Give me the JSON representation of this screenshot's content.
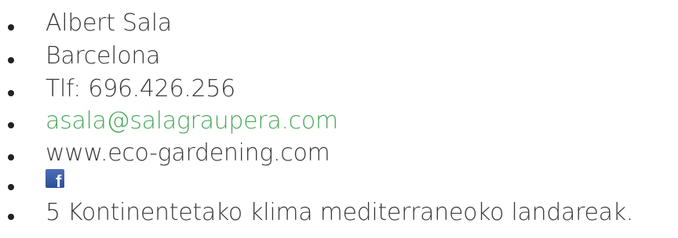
{
  "contact": {
    "name": "Albert Sala",
    "city": "Barcelona",
    "phone": "Tlf: 696.426.256",
    "email": "asala@salagraupera.com",
    "website": "www.eco-gardening.com",
    "facebook_icon": "facebook-icon",
    "description": "5 Kontinentetako klima mediterraneoko landareak."
  },
  "colors": {
    "text": "#3a3a3a",
    "link": "#4aa85a",
    "facebook": "#3b5998"
  }
}
